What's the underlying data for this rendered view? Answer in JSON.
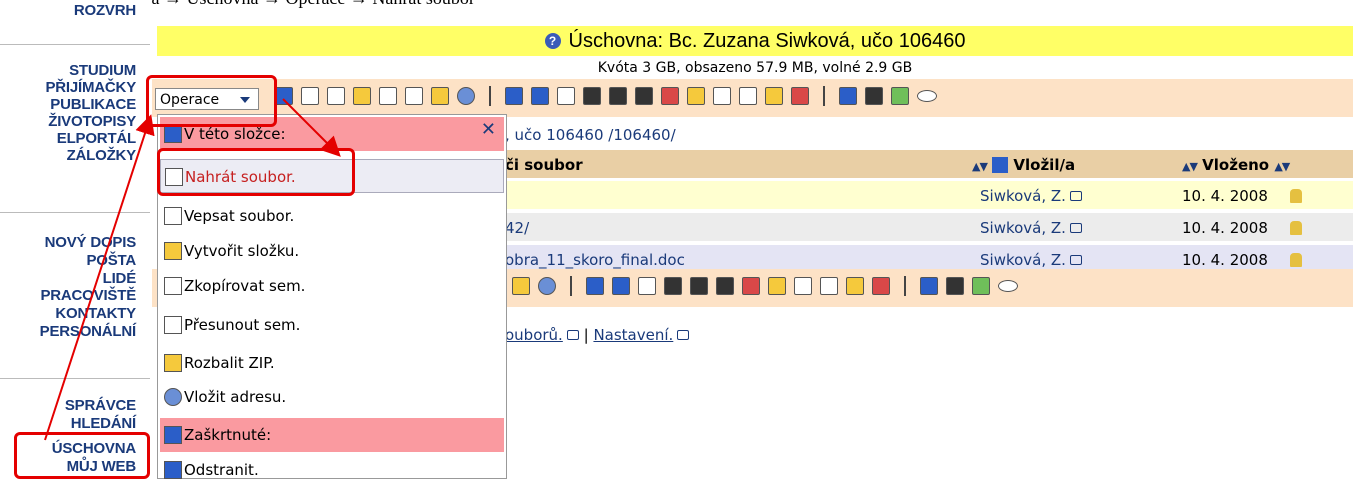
{
  "breadcrumb": "Osobní administrativa → Úschovna → Operace → Nahrát soubor",
  "nav": {
    "items": [
      "ROZVRH",
      "STUDIUM",
      "PŘIJÍMAČKY",
      "PUBLIKACE",
      "ŽIVOTOPISY",
      "ELPORTÁL",
      "ZÁLOŽKY",
      "NOVÝ DOPIS",
      "POŠTA",
      "LIDÉ",
      "PRACOVIŠTĚ",
      "KONTAKTY",
      "PERSONÁLNÍ",
      "SPRÁVCE",
      "HLEDÁNÍ",
      "ÚSCHOVNA",
      "MŮJ WEB"
    ]
  },
  "header": {
    "title": "Úschovna: Bc. Zuzana Siwková, učo 106460",
    "quota": "Kvóta 3 GB, obsazeno 57.9 MB, volné 2.9 GB"
  },
  "operations_label": "Operace",
  "path": ", učo 106460 /106460/",
  "table": {
    "col_file": "či soubor",
    "col_owner": "Vložil/a",
    "col_date": "Vloženo",
    "rows": [
      {
        "name": "",
        "owner": "Siwková, Z.",
        "date": "10. 4. 2008"
      },
      {
        "name": "42/",
        "owner": "Siwková, Z.",
        "date": "10. 4. 2008"
      },
      {
        "name": "obra_11_skoro_final.doc",
        "owner": "Siwková, Z.",
        "date": "10. 4. 2008"
      }
    ]
  },
  "bottom": {
    "files_link": "ouborů.",
    "settings_link": "Nastavení."
  },
  "menu": {
    "section_here": "V této složce:",
    "upload": "Nahrát soubor.",
    "write": "Vepsat soubor.",
    "mkdir": "Vytvořit složku.",
    "copy": "Zkopírovat sem.",
    "move": "Přesunout sem.",
    "unzip": "Rozbalit ZIP.",
    "address": "Vložit adresu.",
    "section_checked": "Zaškrtnuté:",
    "delete": "Odstranit."
  },
  "colors": {
    "title_bg": "#ffff66",
    "toolbar_bg": "#fde2c6",
    "highlight": "#e40000",
    "link": "#1a3a7a"
  }
}
